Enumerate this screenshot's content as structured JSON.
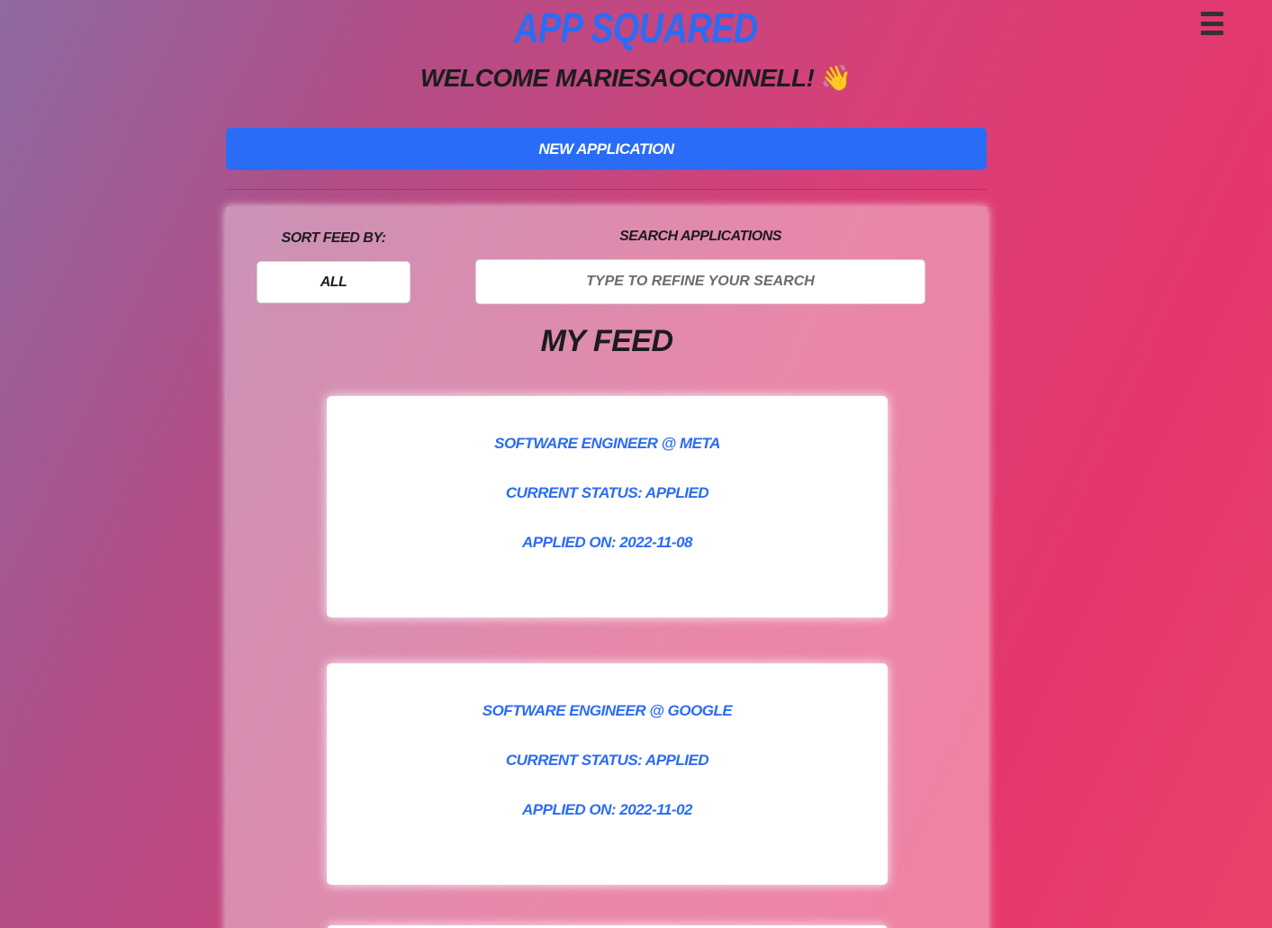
{
  "header": {
    "app_title": "App Squared",
    "menu_icon": "hamburger-menu-icon",
    "welcome_prefix": "Welcome",
    "username": "mariesaoconnell!",
    "wave_emoji": "👋"
  },
  "actions": {
    "new_application_label": "New Application"
  },
  "controls": {
    "sort_label": "Sort Feed By:",
    "sort_value": "All",
    "search_label": "Search Applications",
    "search_placeholder": "Type to refine your search"
  },
  "feed": {
    "title": "My Feed",
    "cards": [
      {
        "position": "Software Engineer @ Meta",
        "status": "Current Status: applied",
        "applied_on": "Applied On: 2022-11-08"
      },
      {
        "position": "Software Engineer @ Google",
        "status": "Current Status: applied",
        "applied_on": "Applied On: 2022-11-02"
      }
    ]
  },
  "colors": {
    "accent": "#2a6cf5",
    "text_dark": "#1c1c1c"
  }
}
